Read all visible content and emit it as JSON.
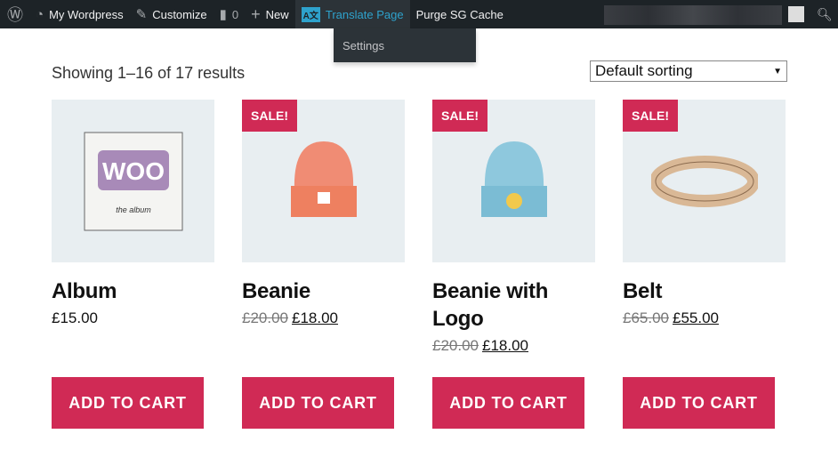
{
  "adminbar": {
    "site": "My Wordpress",
    "customize": "Customize",
    "comments": "0",
    "new": "New",
    "translate": "Translate Page",
    "purge": "Purge SG Cache",
    "dropdown_settings": "Settings"
  },
  "shop": {
    "count": "Showing 1–16 of 17 results",
    "sorting": "Default sorting",
    "add_to_cart": "ADD TO CART",
    "sale_badge": "SALE!"
  },
  "products": [
    {
      "name": "Album",
      "price": "£15.00"
    },
    {
      "name": "Beanie",
      "old_price": "£20.00",
      "price": "£18.00"
    },
    {
      "name": "Beanie with Logo",
      "old_price": "£20.00",
      "price": "£18.00"
    },
    {
      "name": "Belt",
      "old_price": "£65.00",
      "price": "£55.00"
    }
  ],
  "colors": {
    "accent": "#d02a55",
    "adminbar": "#1d2327",
    "active_link": "#2ea2cc"
  }
}
